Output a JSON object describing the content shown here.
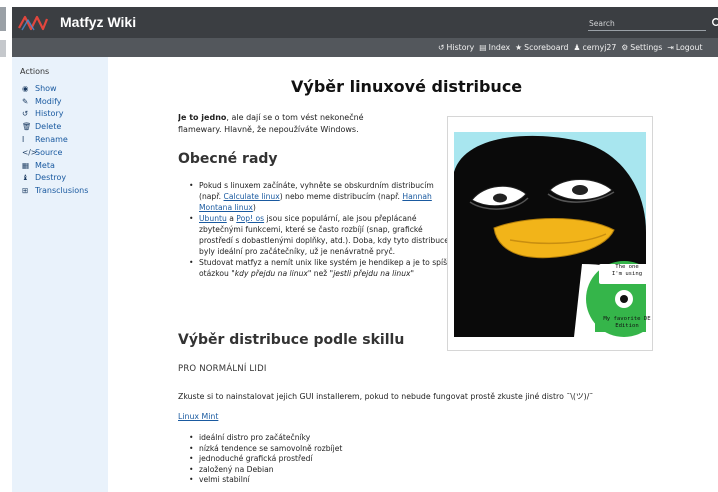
{
  "brand": {
    "name": "Matfyz Wiki",
    "logo": "zigzag-logo",
    "colors": {
      "logo_red": "#e2463d",
      "logo_blue": "#4a90d9",
      "topbar": "#3b3e42",
      "subbar": "#53575c",
      "sidebar": "#e9f2fb",
      "link": "#1a5aa0"
    }
  },
  "search": {
    "placeholder": "Search",
    "icon": "search-icon"
  },
  "nav": {
    "history": {
      "icon": "history-icon",
      "label": "History"
    },
    "index": {
      "icon": "index-icon",
      "label": "Index"
    },
    "scoreboard": {
      "icon": "star-icon",
      "label": "Scoreboard"
    },
    "user": {
      "icon": "user-icon",
      "label": "cernyj27"
    },
    "settings": {
      "icon": "gear-icon",
      "label": "Settings"
    },
    "logout": {
      "icon": "logout-icon",
      "label": "Logout"
    }
  },
  "sidebar": {
    "title": "Actions",
    "items": [
      {
        "icon": "eye-icon",
        "glyph": "◉",
        "label": "Show"
      },
      {
        "icon": "pencil-icon",
        "glyph": "✎",
        "label": "Modify"
      },
      {
        "icon": "history-icon",
        "glyph": "↺",
        "label": "History"
      },
      {
        "icon": "trash-icon",
        "glyph": "🗑",
        "label": "Delete"
      },
      {
        "icon": "cursor-icon",
        "glyph": "I",
        "label": "Rename"
      },
      {
        "icon": "code-icon",
        "glyph": "</>",
        "label": "Source"
      },
      {
        "icon": "table-icon",
        "glyph": "▦",
        "label": "Meta"
      },
      {
        "icon": "destroy-icon",
        "glyph": "♝",
        "label": "Destroy"
      },
      {
        "icon": "transclusion-icon",
        "glyph": "⊞",
        "label": "Transclusions"
      }
    ]
  },
  "page": {
    "title": "Výběr linuxové distribuce",
    "intro_bold": "Je to jedno",
    "intro_rest": ", ale dají se o tom vést nekonečné flamewary. Hlavně, že nepoužíváte Windows.",
    "section1": "Obecné rady",
    "tips": {
      "t1a": "Pokud s linuxem začínáte, vyhněte se obskurdním distribucím (např. ",
      "t1link1": "Calculate linux",
      "t1b": ") nebo meme distribucím (např. ",
      "t1link2": "Hannah Montana linux",
      "t1c": ")",
      "t2link1": "Ubuntu",
      "t2a": " a ",
      "t2link2": "Pop! os",
      "t2b": " jsou sice populární, ale jsou přeplácané zbytečnými funkcemi, které se často rozbíjí (snap, grafické prostředí s dobastlenými doplňky, atd.). Doba, kdy tyto distribuce byly ideální pro začátečníky, už je nenávratně pryč.",
      "t3a": "Studovat matfyz a nemít unix like systém je hendikep a je to spíš otázkou \"",
      "t3i1": "kdy přejdu na linux",
      "t3b": "\" než \"",
      "t3i2": "jestli přejdu na linux",
      "t3c": "\""
    },
    "section2": "Výběr distribuce podle skillu",
    "subsection": "PRO NORMÁLNÍ LIDI",
    "paragraph": "Zkuste si to nainstalovat jejich GUI installerem, pokud to nebude fungovat prostě zkuste jiné distro ¯\\(ツ)/¯",
    "mint_link": "Linux Mint",
    "mint_points": [
      "ideální distro pro začátečníky",
      "nízká tendence se samovolně rozbíjet",
      "jednoduché grafická prostředí",
      "založený na Debian",
      "velmi stabilní"
    ]
  },
  "meme": {
    "cd_line1": "The one",
    "cd_line2": "I'm using",
    "cd_line3": "My favorite DE",
    "cd_line4": "Edition"
  }
}
